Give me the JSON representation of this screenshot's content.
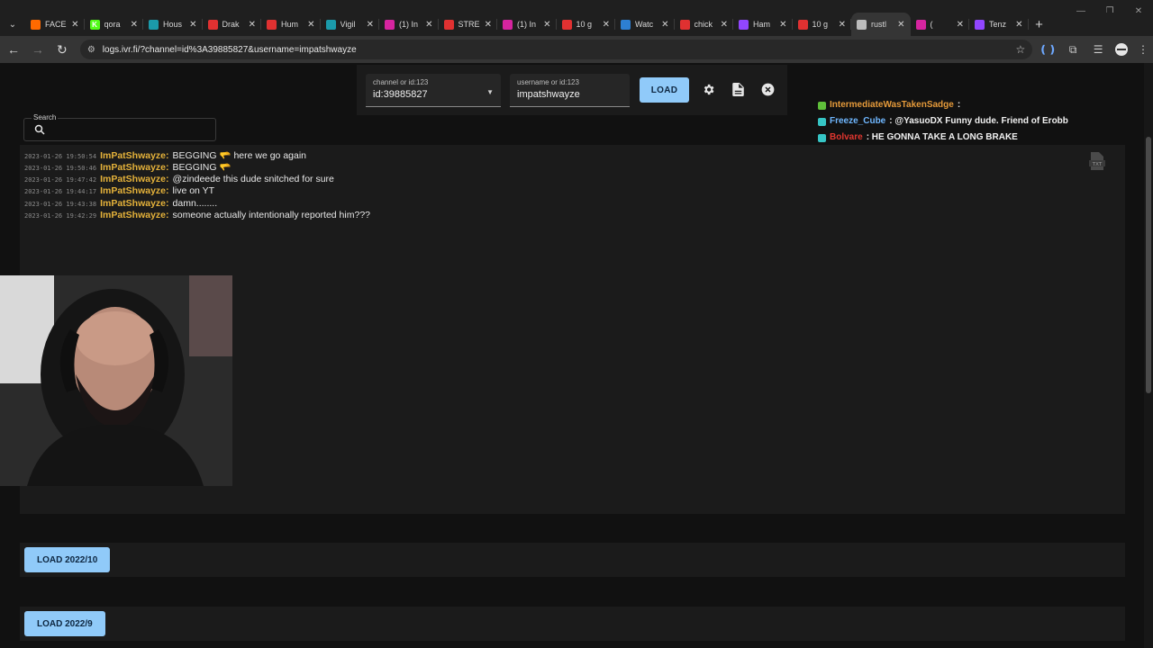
{
  "browser": {
    "tabs": [
      {
        "title": "FACE",
        "color": "#ff6a00",
        "glyph": ""
      },
      {
        "title": "qora",
        "color": "#53fc18",
        "glyph": "K"
      },
      {
        "title": "Hous",
        "color": "#1b9aaa",
        "glyph": ""
      },
      {
        "title": "Drak",
        "color": "#e03131",
        "glyph": ""
      },
      {
        "title": "Hum",
        "color": "#e03131",
        "glyph": ""
      },
      {
        "title": "Vigil",
        "color": "#1b9aaa",
        "glyph": ""
      },
      {
        "title": "(1) In",
        "color": "#d6249f",
        "glyph": ""
      },
      {
        "title": "STRE",
        "color": "#e03131",
        "glyph": ""
      },
      {
        "title": "(1) In",
        "color": "#d6249f",
        "glyph": ""
      },
      {
        "title": "10 g",
        "color": "#e03131",
        "glyph": ""
      },
      {
        "title": "Watc",
        "color": "#2d7fd3",
        "glyph": ""
      },
      {
        "title": "chick",
        "color": "#e03131",
        "glyph": ""
      },
      {
        "title": "Ham",
        "color": "#9146ff",
        "glyph": ""
      },
      {
        "title": "10 g",
        "color": "#e03131",
        "glyph": ""
      },
      {
        "title": "rustl",
        "color": "#bdbdbd",
        "glyph": ""
      },
      {
        "title": "(",
        "color": "#d6249f",
        "glyph": ""
      },
      {
        "title": "Tenz",
        "color": "#9146ff",
        "glyph": ""
      }
    ],
    "url": "logs.ivr.fi/?channel=id%3A39885827&username=impatshwayze"
  },
  "form": {
    "channel_label": "channel or id:123",
    "channel_value": "id:39885827",
    "username_label": "username or id:123",
    "username_value": "impatshwayze",
    "load_label": "LOAD"
  },
  "search": {
    "label": "Search"
  },
  "chat_overlay": [
    {
      "user": "IntermediateWasTakenSadge",
      "user_color": "#e59a3a",
      "text": " :",
      "badge_color": "#5fbf3a"
    },
    {
      "user": "Freeze_Cube",
      "user_color": "#6fb7ff",
      "text": " : @YasuoDX Funny dude. Friend of Erobb",
      "badge_color": "#36c5c5"
    },
    {
      "user": "Bolvare",
      "user_color": "#e0362f",
      "text": " : HE GONNA TAKE A LONG BRAKE",
      "badge_color": "#36c5c5"
    }
  ],
  "logs": [
    {
      "time": "2023-01-26 19:50:54",
      "user": "ImPatShwayze:",
      "message": "BEGGING 🫳 here we go again"
    },
    {
      "time": "2023-01-26 19:50:46",
      "user": "ImPatShwayze:",
      "message": "BEGGING 🫳"
    },
    {
      "time": "2023-01-26 19:47:42",
      "user": "ImPatShwayze:",
      "message": "@zindeede this dude snitched for sure"
    },
    {
      "time": "2023-01-26 19:44:17",
      "user": "ImPatShwayze:",
      "message": "live on YT"
    },
    {
      "time": "2023-01-26 19:43:38",
      "user": "ImPatShwayze:",
      "message": "damn........"
    },
    {
      "time": "2023-01-26 19:42:29",
      "user": "ImPatShwayze:",
      "message": "someone actually intentionally reported him???"
    }
  ],
  "load_months": [
    {
      "label": "LOAD 2022/10"
    },
    {
      "label": "LOAD 2022/9"
    }
  ],
  "colors": {
    "accent": "#90caf9",
    "username": "#e5b23a"
  }
}
